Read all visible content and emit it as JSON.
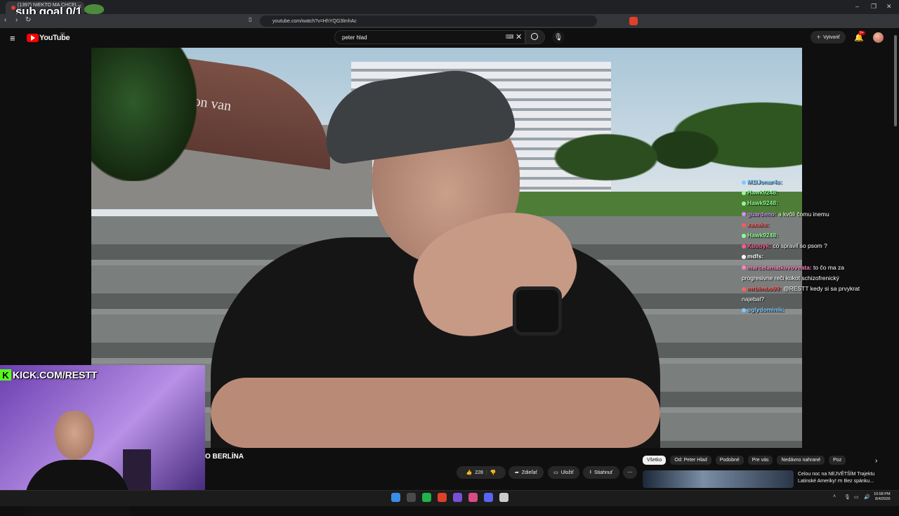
{
  "browser": {
    "tab_title": "(1397) NIEKTO MA CHCEL V...",
    "tab_close": "✕",
    "url": "youtube.com/watch?v=HhYQG3lmhAc",
    "window_controls": [
      "–",
      "❐",
      "✕"
    ]
  },
  "overlay": {
    "sub_goal": "sub goal 0/1",
    "kick_letter": "K",
    "kick_text": "KICK.COM/RESTT"
  },
  "youtube": {
    "logo_text": "YouTube",
    "region": "SK",
    "search_value": "peter hlad",
    "create_label": "Vytvoriť",
    "notif_badge": "9+",
    "video_title": "O BERLÍNA",
    "like_count": "228",
    "share_label": "Zdieľať",
    "save_label": "Uložiť",
    "download_label": "Stiahnuť",
    "more_label": "⋯",
    "chips": [
      "Všetko",
      "Od: Peter Hlad",
      "Podobné",
      "Pre vás",
      "Nedávno nahrané",
      "Poz"
    ],
    "next_chip": "›",
    "rec_title": "Celou noc na NEJVĚTŠÍM Trajektu Latinské Ameriky! ⅿ Bez spánku..."
  },
  "video_scene": {
    "wall_text": "komen uit de bron van"
  },
  "chat": [
    {
      "user": "M1lJonar4s:",
      "text": "",
      "color": "#7ec8ff"
    },
    {
      "user": "Hawk9248:",
      "text": "",
      "color": "#8dff8d"
    },
    {
      "user": "Hawk9248:",
      "text": "",
      "color": "#8dff8d"
    },
    {
      "user": "guardeno:",
      "text": "a kvôli čomu inemu",
      "color": "#d98cff"
    },
    {
      "user": "xaxaks:",
      "text": "",
      "color": "#ff5a5a"
    },
    {
      "user": "Hawk9248:",
      "text": "",
      "color": "#8dff8d"
    },
    {
      "user": "Kuuuyk:",
      "text": "co spravil so psom ?",
      "color": "#ff5a8a"
    },
    {
      "user": "mdfs:",
      "text": "",
      "color": "#ffffff"
    },
    {
      "user": "marcelamatkovoveata:",
      "text": "to čo ma za",
      "color": "#ff80c0"
    },
    {
      "user": "",
      "text": "progresivne reči kokot schizofrenický",
      "color": "#ffffff"
    },
    {
      "user": "mrbimbo99:",
      "text": "@RESTT kedy si sa prvykrat",
      "color": "#ff6060"
    },
    {
      "user": "",
      "text": "najebal?",
      "color": "#ffffff"
    },
    {
      "user": "uglydominik:",
      "text": "",
      "color": "#7ec8ff"
    }
  ],
  "taskbar": {
    "time": "10:58 PM",
    "date": "8/4/2026",
    "icon_colors": [
      "#3c8ce7",
      "#4a4a4a",
      "#1fb34a",
      "#e0402a",
      "#7a4fd8",
      "#d84b86",
      "#5865f2",
      "#cccccc"
    ]
  }
}
